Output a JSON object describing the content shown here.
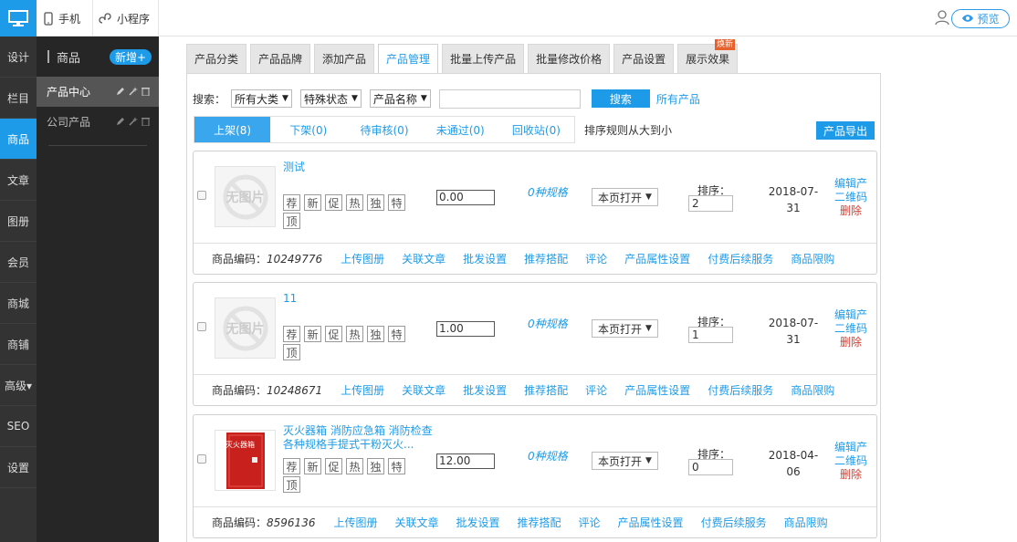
{
  "topbar": {
    "tabs": [
      {
        "label": "手机",
        "icon": "phone-icon"
      },
      {
        "label": "小程序",
        "icon": "mini-program-icon"
      }
    ],
    "preview_label": "预览"
  },
  "leftnav": {
    "items": [
      "设计",
      "栏目",
      "商品",
      "文章",
      "图册",
      "会员",
      "商城",
      "商铺",
      "高级▾",
      "SEO",
      "设置"
    ],
    "active": 2
  },
  "subside": {
    "title": "商品",
    "new_label": "新增+",
    "items": [
      "产品中心",
      "公司产品"
    ]
  },
  "tabs": [
    "产品分类",
    "产品品牌",
    "添加产品",
    "产品管理",
    "批量上传产品",
    "批量修改价格",
    "产品设置",
    "展示效果"
  ],
  "tab_hot_badge": "焕新",
  "search": {
    "label": "搜索：",
    "selects": [
      "所有大类",
      "特殊状态",
      "产品名称"
    ],
    "button": "搜索",
    "all_link": "所有产品"
  },
  "status_tabs": [
    "上架(8)",
    "下架(0)",
    "待审核(0)",
    "未通过(0)",
    "回收站(0)"
  ],
  "sort_rule": "排序规则从大到小",
  "export_label": "产品导出",
  "flags": [
    "荐",
    "新",
    "促",
    "热",
    "独",
    "特",
    "顶"
  ],
  "noimg_label": "无图片",
  "card_labels": {
    "spec": "0种规格",
    "open_select": "本页打开",
    "sort_label": "排序：",
    "edit": "编辑产",
    "qrcode": "二维码",
    "delete": "删除",
    "code_label": "商品编码：",
    "footer_links": [
      "上传图册",
      "关联文章",
      "批发设置",
      "推荐搭配",
      "评论",
      "产品属性设置",
      "付费后续服务",
      "商品限购"
    ]
  },
  "products": [
    {
      "name": "测试",
      "price": "0.00",
      "sort": "2",
      "date_line1": "2018-07-",
      "date_line2": "31",
      "code": "10249776",
      "has_image": false
    },
    {
      "name": "11",
      "price": "1.00",
      "sort": "1",
      "date_line1": "2018-07-",
      "date_line2": "31",
      "code": "10248671",
      "has_image": false
    },
    {
      "name": "灭火器箱 消防应急箱 消防检查 各种规格手提式干粉灭火...",
      "price": "12.00",
      "sort": "0",
      "date_line1": "2018-04-",
      "date_line2": "06",
      "code": "8596136",
      "has_image": true,
      "image_text": "灭火器箱"
    }
  ],
  "colors": {
    "accent": "#1e9be8",
    "danger": "#d23f31",
    "dark_nav": "#333333"
  }
}
